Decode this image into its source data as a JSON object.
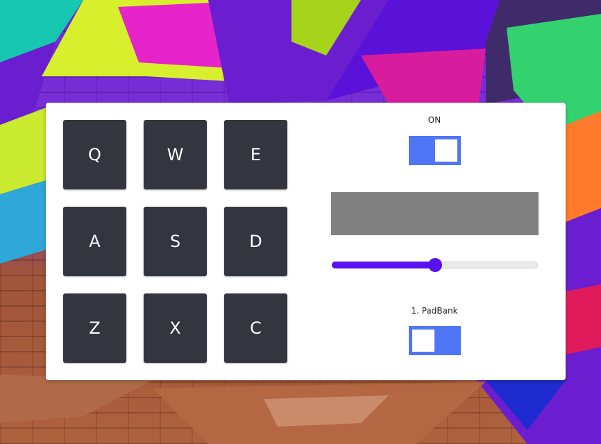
{
  "pads": [
    {
      "key": "Q"
    },
    {
      "key": "W"
    },
    {
      "key": "E"
    },
    {
      "key": "A"
    },
    {
      "key": "S"
    },
    {
      "key": "D"
    },
    {
      "key": "Z"
    },
    {
      "key": "X"
    },
    {
      "key": "C"
    }
  ],
  "controls": {
    "power": {
      "label": "ON",
      "checked": true
    },
    "display": {
      "text": ""
    },
    "volume": {
      "value": 0.5
    },
    "bank": {
      "label": "1. PadBank",
      "checked": false
    }
  },
  "colors": {
    "accent": "#4f76f6",
    "slider": "#5a11f0",
    "pad": "#33363e",
    "display": "#808080"
  }
}
